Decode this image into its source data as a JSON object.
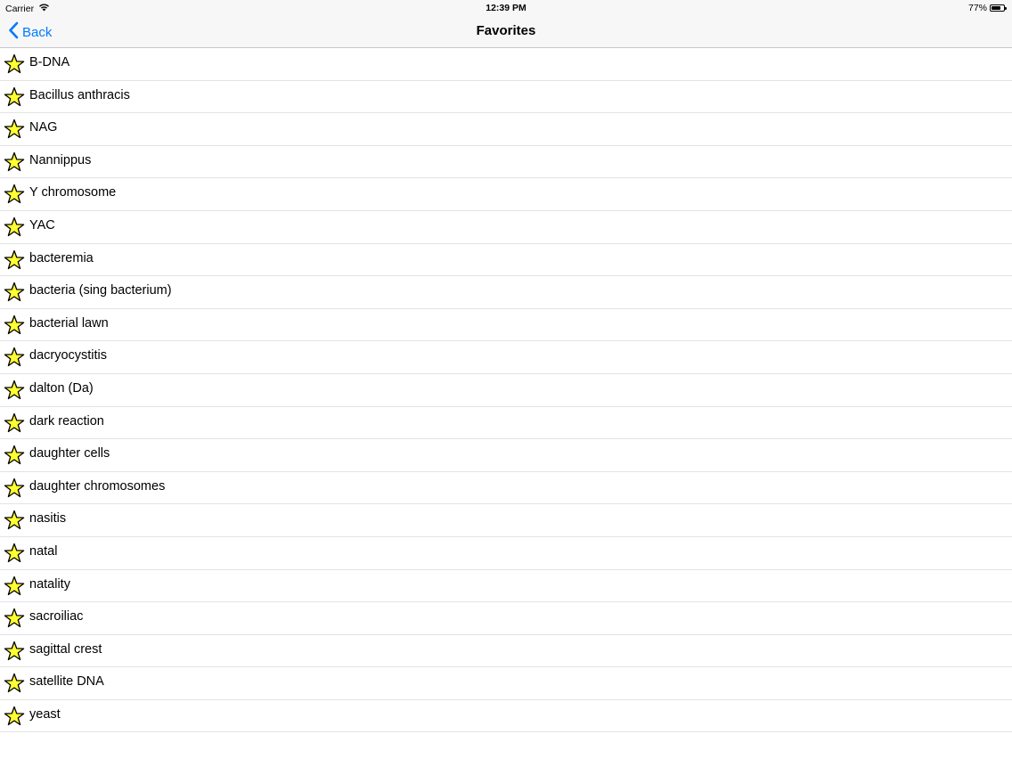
{
  "status_bar": {
    "carrier": "Carrier",
    "time": "12:39 PM",
    "battery": "77%",
    "battery_level": 0.77
  },
  "nav": {
    "back_label": "Back",
    "title": "Favorites"
  },
  "favorites": [
    "B-DNA",
    "Bacillus anthracis",
    "NAG",
    "Nannippus",
    "Y chromosome",
    "YAC",
    "bacteremia",
    "bacteria (sing bacterium)",
    "bacterial lawn",
    "dacryocystitis",
    "dalton (Da)",
    "dark reaction",
    "daughter cells",
    "daughter chromosomes",
    "nasitis",
    "natal",
    "natality",
    "sacroiliac",
    "sagittal crest",
    "satellite DNA",
    "yeast"
  ],
  "icons": {
    "row_icon": "star-icon",
    "back_icon": "chevron-left-icon",
    "wifi_icon": "wifi-icon",
    "battery_icon": "battery-icon"
  },
  "colors": {
    "accent": "#007aff",
    "star_fill": "#ffff33",
    "star_stroke": "#000000",
    "bar_background": "#f7f7f7",
    "separator": "#e3e3e6"
  }
}
